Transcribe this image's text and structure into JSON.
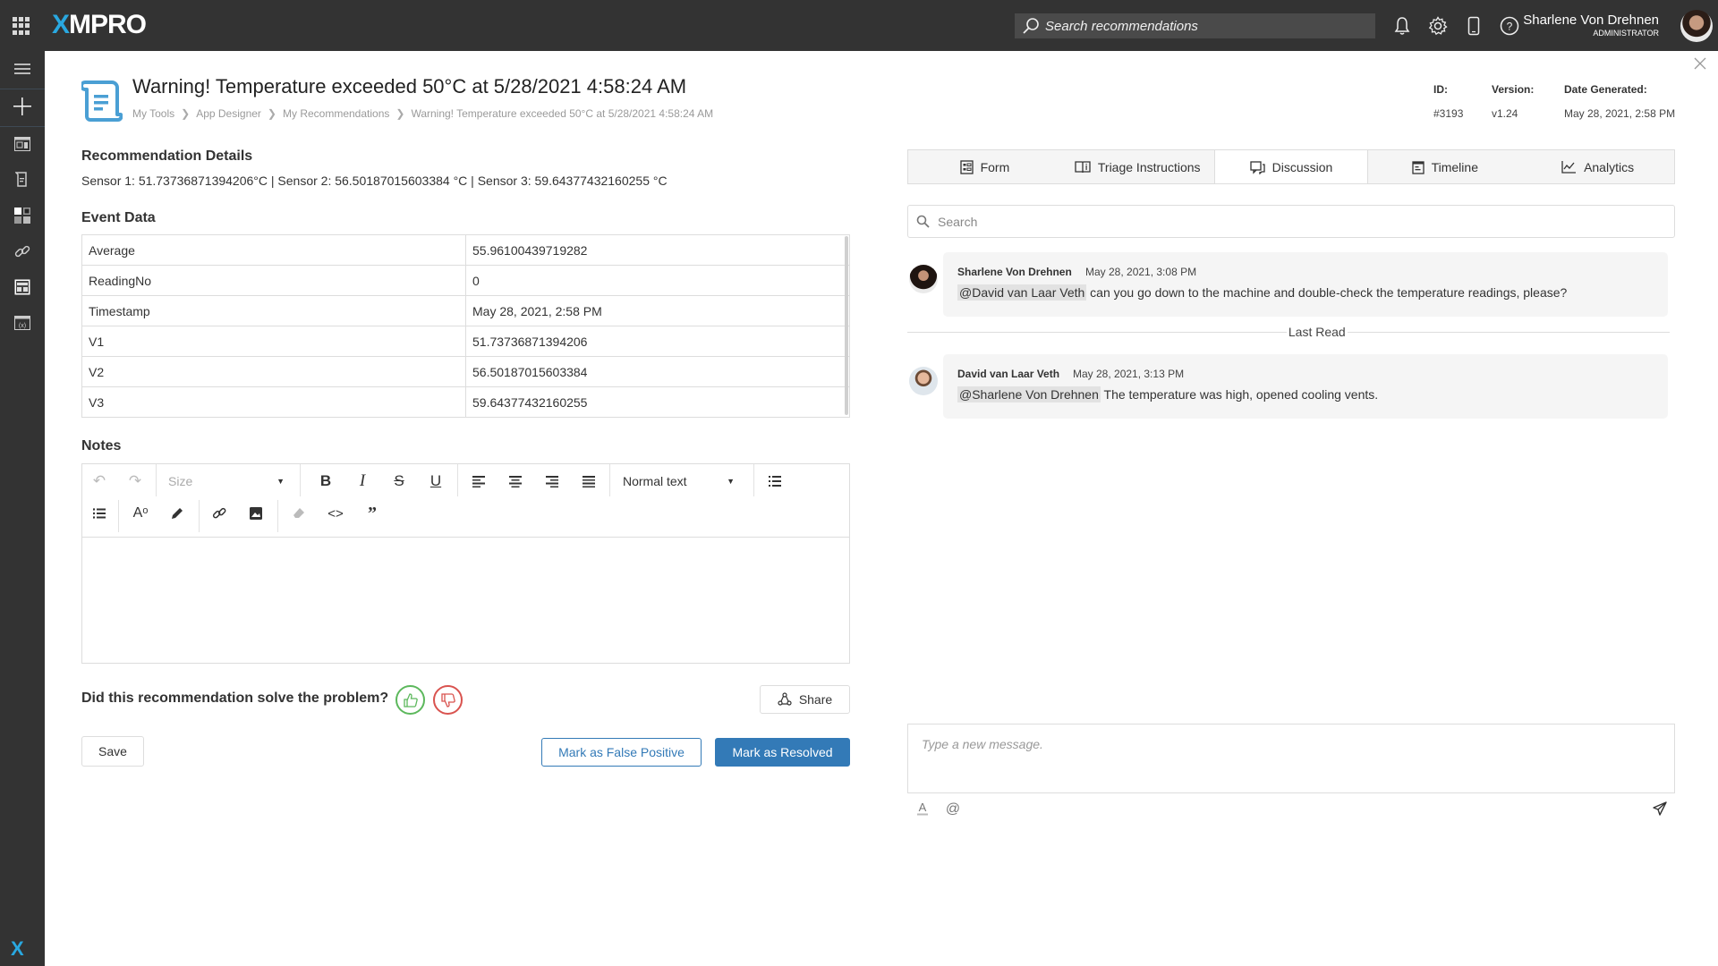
{
  "header": {
    "logo": {
      "prefix": "X",
      "rest": "MPRO"
    },
    "search_placeholder": "Search recommendations",
    "icons": [
      "bell-icon",
      "gear-icon",
      "mobile-icon",
      "help-icon"
    ],
    "user": {
      "name": "Sharlene Von Drehnen",
      "role": "ADMINISTRATOR"
    }
  },
  "sidebar": {
    "items": [
      "menu-icon",
      "add-icon",
      "dashboard-icon",
      "recommendation-icon",
      "widgets-icon",
      "link-icon",
      "app-icon",
      "variable-icon"
    ],
    "footer_logo": "X"
  },
  "page": {
    "title": "Warning! Temperature exceeded 50°C at 5/28/2021 4:58:24 AM",
    "breadcrumb": [
      "My Tools",
      "App Designer",
      "My Recommendations",
      "Warning! Temperature exceeded 50°C at 5/28/2021 4:58:24 AM"
    ],
    "meta": {
      "id_label": "ID:",
      "id_value": "#3193",
      "version_label": "Version:",
      "version_value": "v1.24",
      "date_label": "Date Generated:",
      "date_value": "May 28, 2021, 2:58 PM"
    }
  },
  "details": {
    "heading": "Recommendation Details",
    "text": "Sensor 1: 51.73736871394206°C | Sensor 2: 56.50187015603384 °C | Sensor 3: 59.64377432160255 °C"
  },
  "event_data": {
    "heading": "Event Data",
    "rows": [
      [
        "Average",
        "55.96100439719282"
      ],
      [
        "ReadingNo",
        "0"
      ],
      [
        "Timestamp",
        "May 28, 2021, 2:58 PM"
      ],
      [
        "V1",
        "51.73736871394206"
      ],
      [
        "V2",
        "56.50187015603384"
      ],
      [
        "V3",
        "59.64377432160255"
      ]
    ]
  },
  "notes": {
    "heading": "Notes",
    "size_select": "Size",
    "style_select": "Normal text",
    "content": ""
  },
  "feedback": {
    "question": "Did this recommendation solve the problem?",
    "share_label": "Share"
  },
  "actions": {
    "save": "Save",
    "false_positive": "Mark as False Positive",
    "resolved": "Mark as Resolved"
  },
  "tabs": [
    {
      "label": "Form",
      "icon": "form-icon",
      "active": false
    },
    {
      "label": "Triage Instructions",
      "icon": "book-icon",
      "active": false
    },
    {
      "label": "Discussion",
      "icon": "chat-icon",
      "active": true
    },
    {
      "label": "Timeline",
      "icon": "timeline-icon",
      "active": false
    },
    {
      "label": "Analytics",
      "icon": "analytics-icon",
      "active": false
    }
  ],
  "discussion": {
    "search_placeholder": "Search",
    "messages": [
      {
        "author": "Sharlene Von Drehnen",
        "time": "May 28, 2021, 3:08 PM",
        "mention": "@David van Laar Veth",
        "text": " can you go down to the machine and double-check the temperature readings, please?"
      },
      {
        "author": "David van Laar Veth",
        "time": "May 28, 2021, 3:13 PM",
        "mention": "@Sharlene Von Drehnen",
        "text": " The temperature was high, opened cooling vents."
      }
    ],
    "last_read_label": "Last Read",
    "input_placeholder": "Type a new message."
  },
  "colors": {
    "topbar": "#333333",
    "accent": "#29a8e0",
    "primary": "#337ab7",
    "thumbs_up": "#5cb85c",
    "thumbs_down": "#d9534f"
  }
}
